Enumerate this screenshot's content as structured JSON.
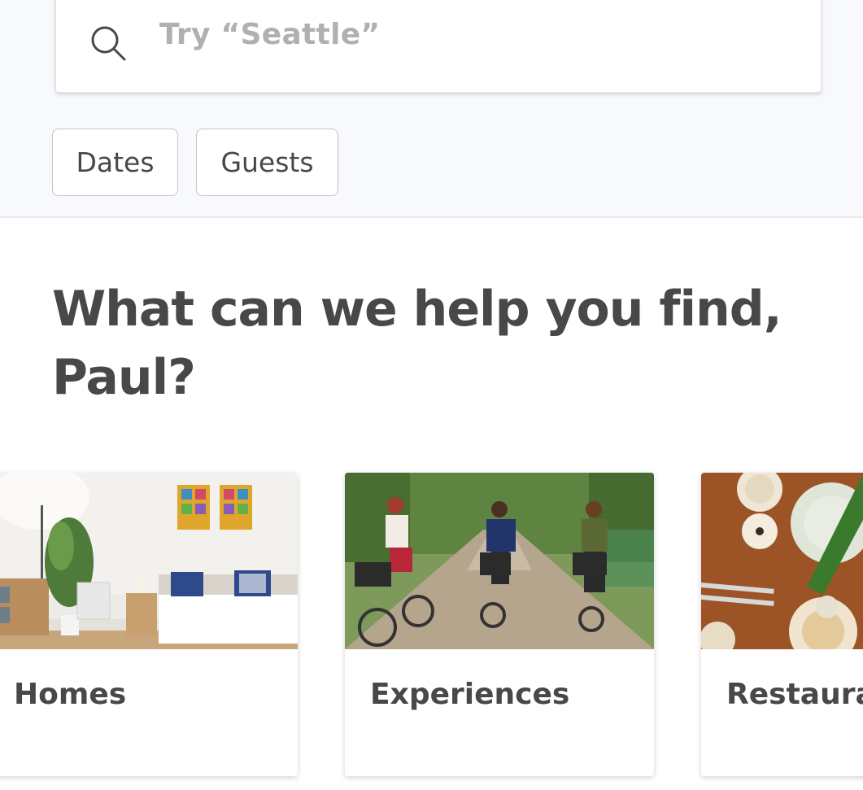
{
  "search": {
    "placeholder": "Try “Seattle”",
    "icon": "search-icon"
  },
  "filters": {
    "dates_label": "Dates",
    "guests_label": "Guests"
  },
  "heading": "What can we help you find, Paul?",
  "categories": [
    {
      "label": "Homes",
      "image": "bedroom-photo"
    },
    {
      "label": "Experiences",
      "image": "cyclists-photo"
    },
    {
      "label": "Restaurants",
      "image": "table-food-photo"
    }
  ],
  "colors": {
    "text": "#484848",
    "placeholder": "#b0b0b0",
    "top_background": "#f7f9fc"
  }
}
